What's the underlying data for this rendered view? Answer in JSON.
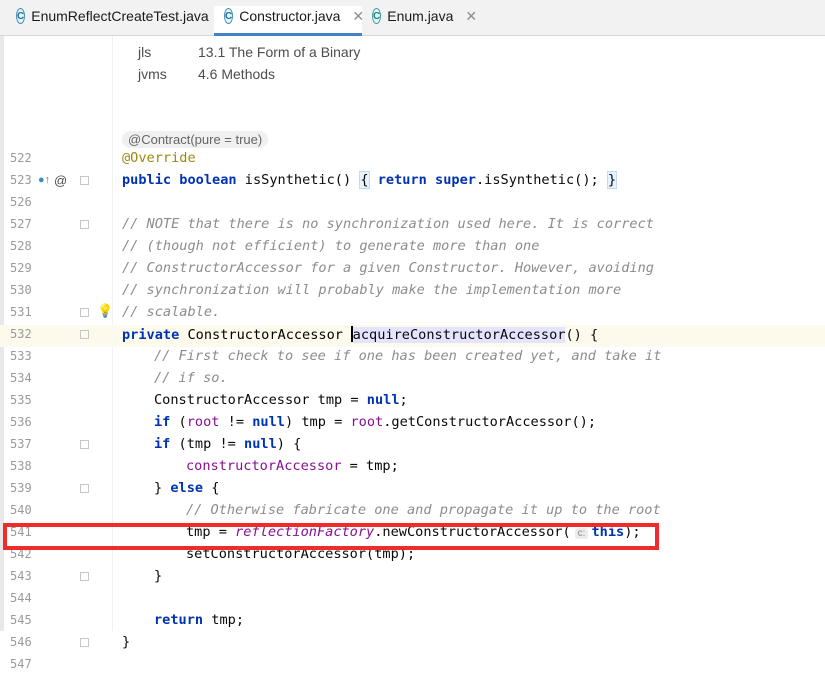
{
  "tabs": [
    {
      "label": "EnumReflectCreateTest.java",
      "icon": "class-icon",
      "active": false
    },
    {
      "label": "Constructor.java",
      "icon": "class-icon",
      "active": true
    },
    {
      "label": "Enum.java",
      "icon": "class-icon",
      "active": false
    }
  ],
  "tab_close": "✕",
  "doc": {
    "rows": [
      {
        "key": "jls",
        "value": "13.1 The Form of a Binary"
      },
      {
        "key": "jvms",
        "value": "4.6 Methods"
      }
    ]
  },
  "contract_hint": "@Contract(pure = true)",
  "lines": [
    {
      "n": "522",
      "text": "@Override"
    },
    {
      "n": "523",
      "text": "public boolean isSynthetic() { return super.isSynthetic(); }"
    },
    {
      "n": "526",
      "text": ""
    },
    {
      "n": "527",
      "text": "// NOTE that there is no synchronization used here. It is correct"
    },
    {
      "n": "528",
      "text": "// (though not efficient) to generate more than one"
    },
    {
      "n": "529",
      "text": "// ConstructorAccessor for a given Constructor. However, avoiding"
    },
    {
      "n": "530",
      "text": "// synchronization will probably make the implementation more"
    },
    {
      "n": "531",
      "text": "// scalable."
    },
    {
      "n": "532",
      "text": "private ConstructorAccessor acquireConstructorAccessor() {"
    },
    {
      "n": "533",
      "text": "// First check to see if one has been created yet, and take it"
    },
    {
      "n": "534",
      "text": "// if so."
    },
    {
      "n": "535",
      "text": "ConstructorAccessor tmp = null;"
    },
    {
      "n": "536",
      "text": "if (root != null) tmp = root.getConstructorAccessor();"
    },
    {
      "n": "537",
      "text": "if (tmp != null) {"
    },
    {
      "n": "538",
      "text": "constructorAccessor = tmp;"
    },
    {
      "n": "539",
      "text": "} else {"
    },
    {
      "n": "540",
      "text": "// Otherwise fabricate one and propagate it up to the root"
    },
    {
      "n": "541",
      "text": "tmp = reflectionFactory.newConstructorAccessor( this);"
    },
    {
      "n": "542",
      "text": "setConstructorAccessor(tmp);"
    },
    {
      "n": "543",
      "text": "}"
    },
    {
      "n": "544",
      "text": ""
    },
    {
      "n": "545",
      "text": "return tmp;"
    },
    {
      "n": "546",
      "text": "}"
    },
    {
      "n": "547",
      "text": ""
    }
  ],
  "inlay_hint": "c:",
  "colors": {
    "highlight": "#ef2b2b",
    "keyword": "#0033b3",
    "comment": "#8c8c8c",
    "field": "#871094",
    "annotation": "#9e880d"
  }
}
